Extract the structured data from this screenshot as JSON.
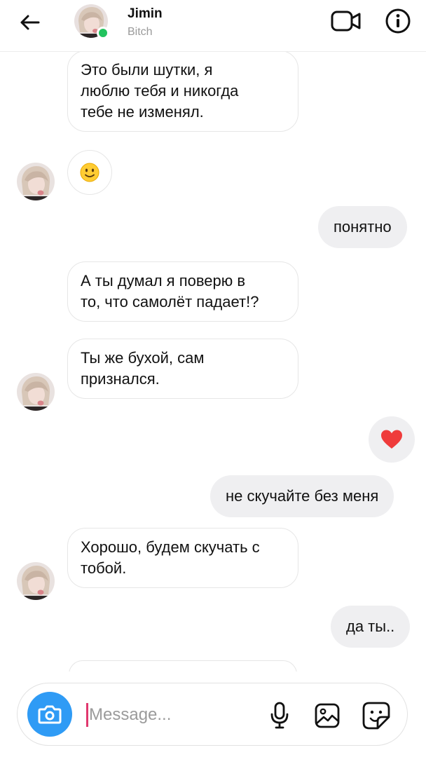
{
  "header": {
    "name": "Jimin",
    "status": "Bitch"
  },
  "messages": [
    {
      "from": "contact",
      "kind": "text",
      "text": "Это были шутки, я\nлюблю тебя и никогда\nтебе не изменял."
    },
    {
      "from": "contact",
      "kind": "emoji",
      "emoji": "slightly-smiling-face"
    },
    {
      "from": "me",
      "kind": "text",
      "text": "понятно"
    },
    {
      "from": "contact",
      "kind": "text",
      "text": "А ты думал я поверю в\nто, что самолёт падает!?"
    },
    {
      "from": "contact",
      "kind": "text",
      "text": "Ты же бухой, сам\nпризнался."
    },
    {
      "from": "me",
      "kind": "emoji",
      "emoji": "heart"
    },
    {
      "from": "me",
      "kind": "text",
      "text": "не скучайте без меня"
    },
    {
      "from": "contact",
      "kind": "text",
      "text": "Хорошо, будем скучать с\nтобой."
    },
    {
      "from": "me",
      "kind": "text",
      "text": "да ты.."
    }
  ],
  "composer": {
    "placeholder": "Message...",
    "value": ""
  },
  "icons": {
    "back": "arrow-left-icon",
    "video": "video-camera-icon",
    "info": "info-icon",
    "camera": "camera-icon",
    "mic": "microphone-icon",
    "gallery": "image-icon",
    "sticker": "sticker-icon"
  },
  "colors": {
    "accent": "#2f9bf5",
    "online": "#22c35e",
    "outgoing_bubble": "#efeff1",
    "heart": "#ef3b3b",
    "caret": "#e0386e"
  }
}
